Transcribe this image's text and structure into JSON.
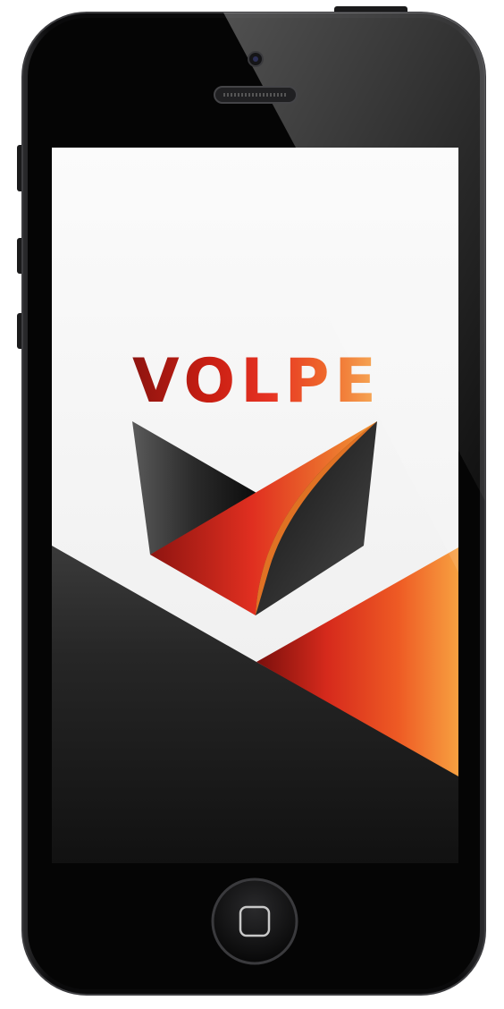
{
  "app": {
    "name": "VOLPE"
  },
  "icons": {
    "logo": "volpe-shield-logo",
    "home_button": "rounded-square-home-icon",
    "camera": "front-camera-icon",
    "speaker": "earpiece-speaker-icon"
  },
  "colors": {
    "screen_background": "#f4f4f4",
    "device_body": "#0b0b0c",
    "dark_panel": "#1c1c1c",
    "brand_dark_red": "#8e1410",
    "brand_red": "#e63323",
    "brand_orange": "#f38a26",
    "brand_light_orange": "#f7b15c"
  }
}
